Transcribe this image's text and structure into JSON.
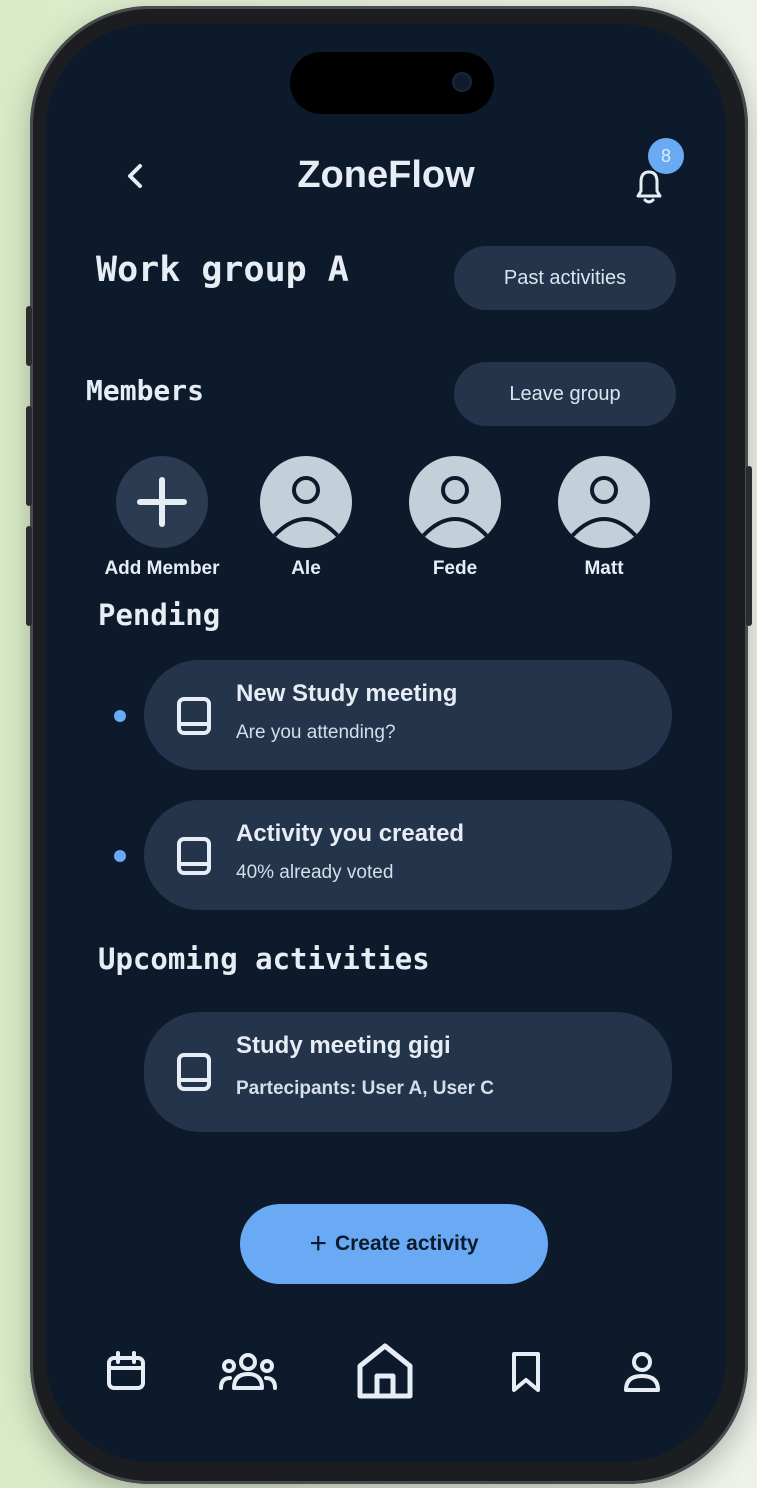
{
  "header": {
    "app_title": "ZoneFlow",
    "notification_count": "8",
    "back_icon": "chevron-left-icon",
    "bell_icon": "bell-icon"
  },
  "group": {
    "name": "Work group A",
    "past_activities_label": "Past activities",
    "leave_group_label": "Leave group",
    "members_title": "Members"
  },
  "members": [
    {
      "name": "Add Member",
      "icon": "plus-icon"
    },
    {
      "name": "Ale",
      "icon": "person-icon"
    },
    {
      "name": "Fede",
      "icon": "person-icon"
    },
    {
      "name": "Matt",
      "icon": "person-icon"
    }
  ],
  "pending": {
    "title": "Pending",
    "items": [
      {
        "title": "New Study meeting",
        "subtitle": "Are you attending?",
        "icon": "book-icon",
        "unread": true
      },
      {
        "title": "Activity you created",
        "subtitle": "40% already voted",
        "icon": "book-icon",
        "unread": true
      }
    ]
  },
  "upcoming": {
    "title": "Upcoming activities",
    "items": [
      {
        "title": "Study meeting gigi",
        "subtitle": "Partecipants: User A, User C",
        "icon": "book-icon"
      }
    ]
  },
  "actions": {
    "create_label": "Create activity",
    "create_icon": "plus-icon"
  },
  "bottom_nav": [
    {
      "icon": "calendar-icon"
    },
    {
      "icon": "people-icon"
    },
    {
      "icon": "home-icon",
      "active": true
    },
    {
      "icon": "bookmark-icon"
    },
    {
      "icon": "user-icon"
    }
  ],
  "colors": {
    "background": "#0c1a2b",
    "card": "#24344a",
    "accent": "#6aa9f3",
    "text": "#e6edf5"
  }
}
